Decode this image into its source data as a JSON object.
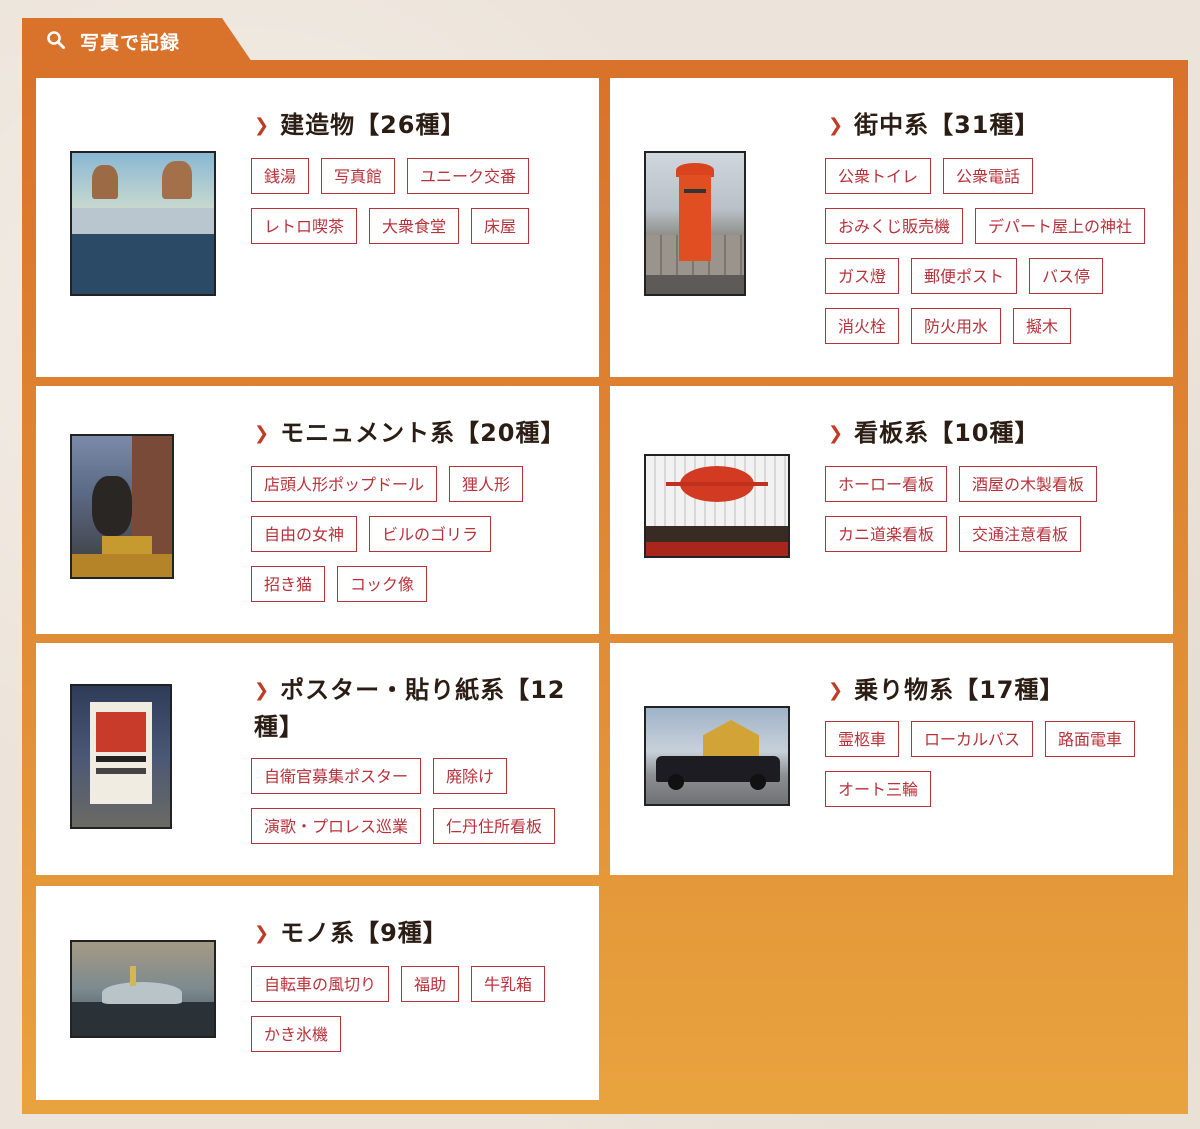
{
  "header": {
    "title": "写真で記録",
    "icon": "search-icon"
  },
  "colors": {
    "accent": "#d9722a",
    "tag": "#b8323a",
    "chevron": "#c23b24"
  },
  "categories": [
    {
      "title": "建造物【26種】",
      "tags": [
        "銭湯",
        "写真館",
        "ユニーク交番",
        "レトロ喫茶",
        "大衆食堂",
        "床屋"
      ]
    },
    {
      "title": "街中系【31種】",
      "tags": [
        "公衆トイレ",
        "公衆電話",
        "おみくじ販売機",
        "デパート屋上の神社",
        "ガス燈",
        "郵便ポスト",
        "バス停",
        "消火栓",
        "防火用水",
        "擬木"
      ]
    },
    {
      "title": "モニュメント系【20種】",
      "tags": [
        "店頭人形ポップドール",
        "狸人形",
        "自由の女神",
        "ビルのゴリラ",
        "招き猫",
        "コック像"
      ]
    },
    {
      "title": "看板系【10種】",
      "tags": [
        "ホーロー看板",
        "酒屋の木製看板",
        "カニ道楽看板",
        "交通注意看板"
      ]
    },
    {
      "title": "ポスター・貼り紙系【12種】",
      "tags": [
        "自衛官募集ポスター",
        "廃除け",
        "演歌・プロレス巡業",
        "仁丹住所看板"
      ]
    },
    {
      "title": "乗り物系【17種】",
      "tags": [
        "霊柩車",
        "ローカルバス",
        "路面電車",
        "オート三輪"
      ]
    },
    {
      "title": "モノ系【9種】",
      "tags": [
        "自転車の風切り",
        "福助",
        "牛乳箱",
        "かき氷機"
      ]
    }
  ]
}
